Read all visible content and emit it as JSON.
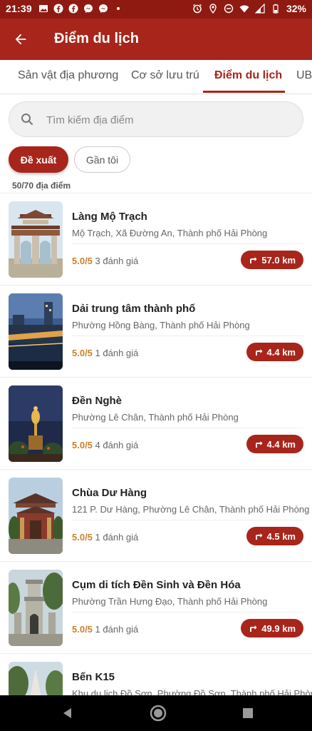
{
  "status_bar": {
    "time": "21:39",
    "battery": "32%"
  },
  "app_bar": {
    "title": "Điểm du lịch"
  },
  "tabs": [
    {
      "label": "Sản vật địa phương"
    },
    {
      "label": "Cơ sở lưu trú"
    },
    {
      "label": "Điểm du lịch"
    },
    {
      "label": "UBND"
    }
  ],
  "search": {
    "placeholder": "Tìm kiếm địa điểm"
  },
  "filters": {
    "recommended": "Đề xuất",
    "nearby": "Gần tôi"
  },
  "count": "50/70 địa điểm",
  "colors": {
    "primary": "#a8251b",
    "status_bar": "#8e1a12",
    "rating": "#c7832e"
  },
  "places": [
    {
      "name": "Làng Mộ Trạch",
      "address": "Mộ Trạch, Xã Đường An, Thành phố Hải Phòng",
      "score": "5.0/5",
      "reviews": "3 đánh giá",
      "distance": "57.0 km"
    },
    {
      "name": "Dải trung tâm thành phố",
      "address": "Phường Hồng Bàng, Thành phố Hải Phòng",
      "score": "5.0/5",
      "reviews": "1 đánh giá",
      "distance": "4.4 km"
    },
    {
      "name": "Đền Nghè",
      "address": "Phường Lê Chân, Thành phố Hải Phòng",
      "score": "5.0/5",
      "reviews": "4 đánh giá",
      "distance": "4.4 km"
    },
    {
      "name": "Chùa Dư Hàng",
      "address": "121 P. Dư Hàng, Phường Lê Chân, Thành phố Hải Phòng",
      "score": "5.0/5",
      "reviews": "1 đánh giá",
      "distance": "4.5 km"
    },
    {
      "name": "Cụm di tích Đền Sinh và Đền Hóa",
      "address": "Phường Trần Hưng Đạo, Thành phố Hải Phòng",
      "score": "5.0/5",
      "reviews": "1 đánh giá",
      "distance": "49.9 km"
    },
    {
      "name": "Bến K15",
      "address": "Khu du lịch Đồ Sơn, Phường Đồ Sơn, Thành phố Hải Phòng",
      "score": "",
      "reviews": "",
      "distance": ""
    }
  ],
  "thumb_captions": {
    "item2": "DẢI TRUNG TÂM THÀNH PHỐ",
    "item4": "CHÙA DƯ HÀNG"
  }
}
